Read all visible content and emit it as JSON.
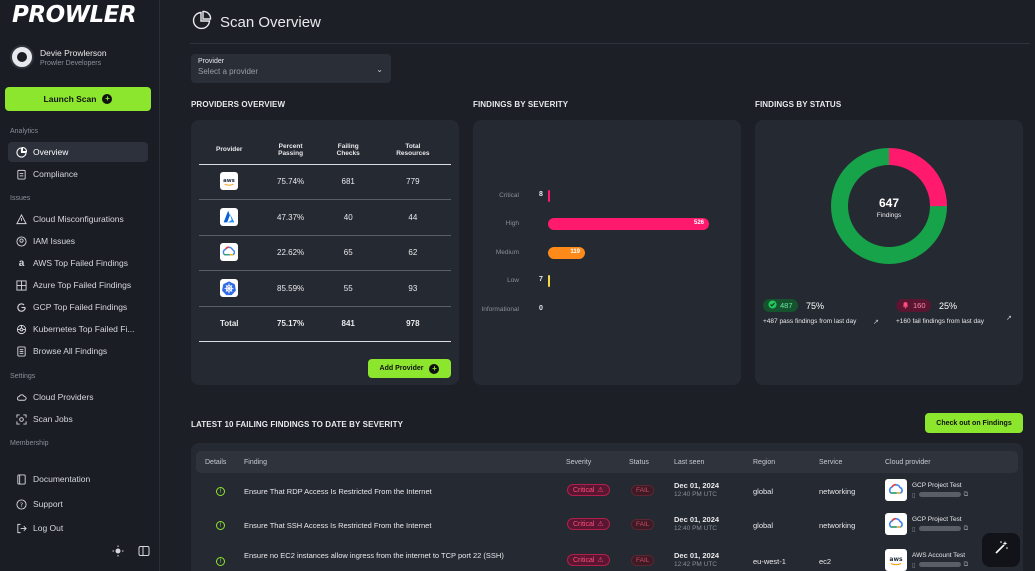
{
  "app": {
    "logo": "PROWLER"
  },
  "user": {
    "name": "Devie Prowlerson",
    "org": "Prowler Developers"
  },
  "sidebar": {
    "launch_scan": "Launch Scan",
    "groups": {
      "analytics": "Analytics",
      "issues": "Issues",
      "settings": "Settings",
      "membership": "Membership"
    },
    "items": {
      "overview": "Overview",
      "compliance": "Compliance",
      "cloud_misconfig": "Cloud Misconfigurations",
      "iam_issues": "IAM Issues",
      "aws_top": "AWS Top Failed Findings",
      "azure_top": "Azure Top Failed Findings",
      "gcp_top": "GCP Top Failed Findings",
      "k8s_top": "Kubernetes Top Failed Fi...",
      "browse_all": "Browse All Findings",
      "cloud_providers": "Cloud Providers",
      "scan_jobs": "Scan Jobs",
      "documentation": "Documentation",
      "support": "Support",
      "logout": "Log Out"
    }
  },
  "header": {
    "title": "Scan Overview"
  },
  "provider_select": {
    "label": "Provider",
    "placeholder": "Select a provider"
  },
  "providers_overview": {
    "title": "PROVIDERS OVERVIEW",
    "columns": [
      "Provider",
      "Percent\nPassing",
      "Failing\nChecks",
      "Total\nResources"
    ],
    "rows": [
      {
        "provider": "aws",
        "percent": "75.74%",
        "failing": "681",
        "total": "779"
      },
      {
        "provider": "azure",
        "percent": "47.37%",
        "failing": "40",
        "total": "44"
      },
      {
        "provider": "gcp",
        "percent": "22.62%",
        "failing": "65",
        "total": "62"
      },
      {
        "provider": "kubernetes",
        "percent": "85.59%",
        "failing": "55",
        "total": "93"
      }
    ],
    "total": {
      "label": "Total",
      "percent": "75.17%",
      "failing": "841",
      "total": "978"
    },
    "add_provider": "Add Provider"
  },
  "severity": {
    "title": "FINDINGS BY SEVERITY",
    "bars": [
      {
        "label": "Critical",
        "value": 8,
        "color": "#ff1a6e"
      },
      {
        "label": "High",
        "value": 526,
        "color": "#ff1a6e"
      },
      {
        "label": "Medium",
        "value": 119,
        "color": "#ff8a1a"
      },
      {
        "label": "Low",
        "value": 7,
        "color": "#f5d84a"
      },
      {
        "label": "Informational",
        "value": 0,
        "color": "#5a9ee0"
      }
    ],
    "max_value": 526
  },
  "status": {
    "title": "FINDINGS BY STATUS",
    "total": "647",
    "total_label": "Findings",
    "pass": {
      "count": "487",
      "pct": "75%",
      "note": "+487 pass findings from last day",
      "color": "#16a34a"
    },
    "fail": {
      "count": "160",
      "pct": "25%",
      "note": "+160 fail findings from last day",
      "color": "#ff1a6e"
    },
    "pass_fraction": 0.75
  },
  "latest": {
    "title": "LATEST 10 FAILING FINDINGS TO DATE BY SEVERITY",
    "check_button": "Check out on Findings",
    "columns": {
      "details": "Details",
      "finding": "Finding",
      "severity": "Severity",
      "status": "Status",
      "last_seen": "Last seen",
      "region": "Region",
      "service": "Service",
      "cloud": "Cloud provider"
    },
    "rows": [
      {
        "finding": "Ensure That RDP Access Is Restricted From the Internet",
        "severity": "Critical",
        "status": "FAIL",
        "date": "Dec 01, 2024",
        "time": "12:40 PM UTC",
        "region": "global",
        "service": "networking",
        "cloud_name": "GCP Project Test",
        "cloud": "gcp"
      },
      {
        "finding": "Ensure That SSH Access Is Restricted From the Internet",
        "severity": "Critical",
        "status": "FAIL",
        "date": "Dec 01, 2024",
        "time": "12:40 PM UTC",
        "region": "global",
        "service": "networking",
        "cloud_name": "GCP Project Test",
        "cloud": "gcp"
      },
      {
        "finding": "Ensure no EC2 instances allow ingress from the internet to TCP port 22 (SSH)",
        "severity": "Critical",
        "status": "FAIL",
        "date": "Dec 01, 2024",
        "time": "12:42 PM UTC",
        "region": "eu-west-1",
        "service": "ec2",
        "cloud_name": "AWS Account Test",
        "cloud": "aws"
      }
    ]
  },
  "colors": {
    "accent": "#8ce62e",
    "bg": "#1c1f26",
    "card": "#252931"
  }
}
